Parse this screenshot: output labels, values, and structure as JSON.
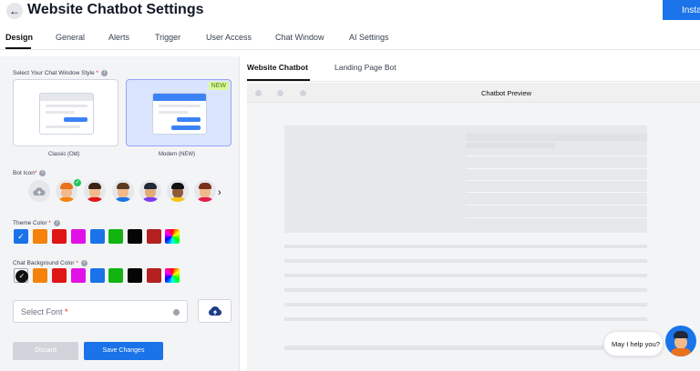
{
  "header": {
    "title": "Website Chatbot Settings",
    "install_label": "Install"
  },
  "tabs": [
    {
      "label": "Design",
      "active": true
    },
    {
      "label": "General"
    },
    {
      "label": "Alerts"
    },
    {
      "label": "Trigger"
    },
    {
      "label": "User Access"
    },
    {
      "label": "Chat Window"
    },
    {
      "label": "AI Settings"
    }
  ],
  "design": {
    "window_style_label": "Select Your Chat Window Style",
    "styles": [
      {
        "caption": "Classic (Old)"
      },
      {
        "caption": "Modern (NEW)",
        "badge": "NEW",
        "selected": true
      }
    ],
    "bot_icon_label": "Bot Icon",
    "theme_color_label": "Theme Color",
    "chat_bg_color_label": "Chat Background Color",
    "theme_colors": [
      "#1a73e8",
      "#f5820b",
      "#e01515",
      "#e211e6",
      "#1a73e8",
      "#11b411",
      "#050505",
      "#b52020"
    ],
    "chat_bg_colors": [
      "#ffffff",
      "#f5820b",
      "#e01515",
      "#e211e6",
      "#1a73e8",
      "#11b411",
      "#050505",
      "#b52020"
    ],
    "font_placeholder": "Select Font",
    "required_mark": "*",
    "discard_label": "Discard",
    "save_label": "Save Changes"
  },
  "preview": {
    "tabs": [
      {
        "label": "Website Chatbot",
        "active": true
      },
      {
        "label": "Landing Page Bot"
      }
    ],
    "title": "Chatbot Preview",
    "help_text": "May I help you?"
  },
  "colors": {
    "primary": "#1a73e8",
    "new_badge_bg": "#d9f99d"
  }
}
